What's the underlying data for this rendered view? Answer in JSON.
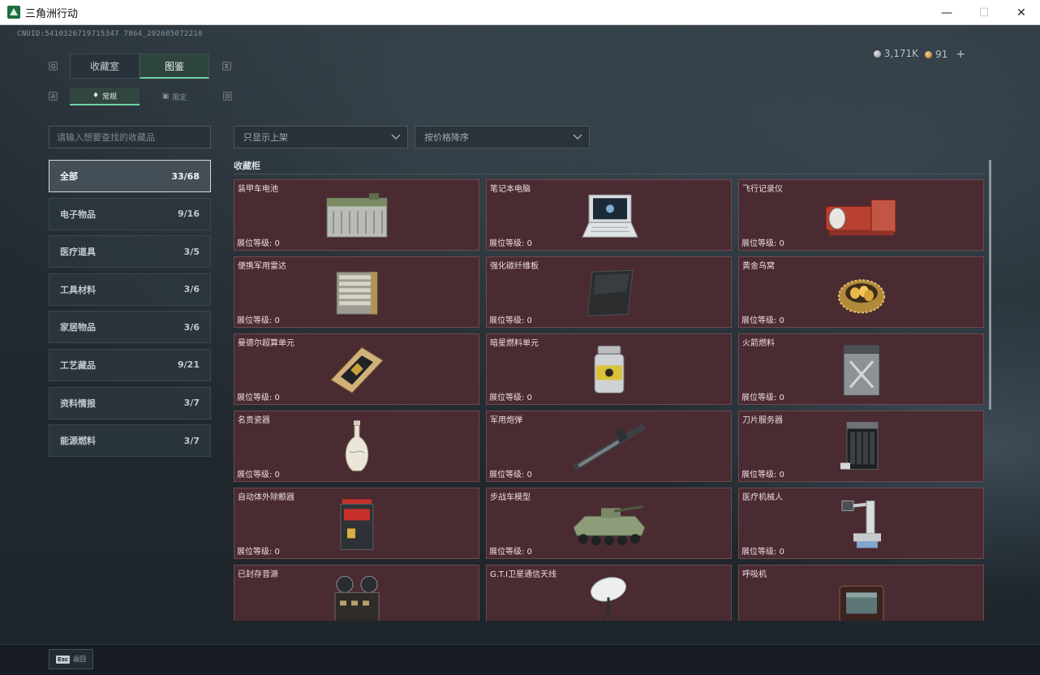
{
  "window": {
    "title": "三角洲行动",
    "minimize": "—",
    "maximize": "☐",
    "close": "✕"
  },
  "uid": "CNUID:5410326719715347 7864_202605072210",
  "currency": {
    "silver": "3,171K",
    "gold": "91",
    "add": "+"
  },
  "hints": {
    "q": "Q",
    "e": "E",
    "a": "A",
    "d": "D"
  },
  "tabs": [
    {
      "label": "收藏室"
    },
    {
      "label": "图鉴"
    }
  ],
  "subtabs": [
    {
      "label": "常规",
      "icon": "flame-icon"
    },
    {
      "label": "限定",
      "icon": "box-icon"
    }
  ],
  "search": {
    "placeholder": "请输入想要查找的收藏品"
  },
  "filters": {
    "shelf": "只显示上架",
    "sort": "按价格降序"
  },
  "categories": [
    {
      "label": "全部",
      "count": "33/68"
    },
    {
      "label": "电子物品",
      "count": "9/16"
    },
    {
      "label": "医疗道具",
      "count": "3/5"
    },
    {
      "label": "工具材料",
      "count": "3/6"
    },
    {
      "label": "家居物品",
      "count": "3/6"
    },
    {
      "label": "工艺藏品",
      "count": "9/21"
    },
    {
      "label": "资料情报",
      "count": "3/7"
    },
    {
      "label": "能源燃料",
      "count": "3/7"
    }
  ],
  "section": {
    "title": "收藏柜"
  },
  "items": [
    {
      "name": "装甲车电池",
      "level": "展位等级: 0",
      "icon": "battery-icon"
    },
    {
      "name": "笔记本电脑",
      "level": "展位等级: 0",
      "icon": "laptop-icon"
    },
    {
      "name": "飞行记录仪",
      "level": "展位等级: 0",
      "icon": "flight-recorder-icon"
    },
    {
      "name": "便携军用雷达",
      "level": "展位等级: 0",
      "icon": "radar-icon"
    },
    {
      "name": "强化碳纤维板",
      "level": "展位等级: 0",
      "icon": "carbon-plate-icon"
    },
    {
      "name": "黄金鸟窝",
      "level": "展位等级: 0",
      "icon": "golden-nest-icon"
    },
    {
      "name": "曼德尔超算单元",
      "level": "展位等级: 0",
      "icon": "chip-icon"
    },
    {
      "name": "暗星燃料单元",
      "level": "展位等级: 0",
      "icon": "fuel-cell-icon"
    },
    {
      "name": "火箭燃料",
      "level": "展位等级: 0",
      "icon": "jerrycan-icon"
    },
    {
      "name": "名贵瓷器",
      "level": "展位等级: 0",
      "icon": "vase-icon"
    },
    {
      "name": "军用炮弹",
      "level": "展位等级: 0",
      "icon": "shell-icon"
    },
    {
      "name": "刀片服务器",
      "level": "展位等级: 0",
      "icon": "server-icon"
    },
    {
      "name": "自动体外除颤器",
      "level": "展位等级: 0",
      "icon": "defibrillator-icon"
    },
    {
      "name": "步战车模型",
      "level": "展位等级: 0",
      "icon": "ifv-model-icon"
    },
    {
      "name": "医疗机械人",
      "level": "展位等级: 0",
      "icon": "medical-robot-icon"
    },
    {
      "name": "已封存音源",
      "level": "",
      "icon": "tape-recorder-icon"
    },
    {
      "name": "G.T.I卫星通信天线",
      "level": "",
      "icon": "satellite-dish-icon"
    },
    {
      "name": "呼吸机",
      "level": "",
      "icon": "ventilator-icon"
    }
  ],
  "footer": {
    "esc_key": "Esc",
    "esc_label": "返回"
  },
  "colors": {
    "card_bg": "#4a2b31",
    "accent": "#6fd3a2",
    "page_bg": "#222a30"
  }
}
